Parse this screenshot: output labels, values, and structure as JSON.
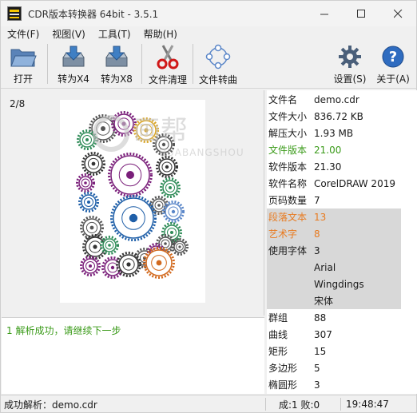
{
  "window": {
    "title": "CDR版本转换器 64bit - 3.5.1"
  },
  "menu": [
    "文件(F)",
    "视图(V)",
    "工具(T)",
    "帮助(H)"
  ],
  "toolbar": {
    "open": "打开",
    "to_x4": "转为X4",
    "to_x8": "转为X8",
    "clean": "文件清理",
    "curve": "文件转曲",
    "settings": "设置(S)",
    "about": "关于(A)"
  },
  "preview": {
    "page_indicator": "2/8"
  },
  "watermark": {
    "text": "画帮",
    "sub": "HUABANGSHOU"
  },
  "info": {
    "rows": [
      {
        "k": "文件名",
        "v": "demo.cdr"
      },
      {
        "k": "文件大小",
        "v": "836.72 KB"
      },
      {
        "k": "解压大小",
        "v": "1.93 MB"
      },
      {
        "k": "文件版本",
        "v": "21.00"
      },
      {
        "k": "软件版本",
        "v": "21.30"
      },
      {
        "k": "软件名称",
        "v": "CorelDRAW 2019"
      },
      {
        "k": "页码数量",
        "v": "7"
      },
      {
        "k": "段落文本",
        "v": "13"
      },
      {
        "k": "艺术字",
        "v": "8"
      },
      {
        "k": "使用字体",
        "v": "3"
      },
      {
        "k": "",
        "v": "Arial"
      },
      {
        "k": "",
        "v": "Wingdings"
      },
      {
        "k": "",
        "v": "宋体"
      },
      {
        "k": "群组",
        "v": "88"
      },
      {
        "k": "曲线",
        "v": "307"
      },
      {
        "k": "矩形",
        "v": "15"
      },
      {
        "k": "多边形",
        "v": "5"
      },
      {
        "k": "椭圆形",
        "v": "3"
      }
    ]
  },
  "log": {
    "line": "1  解析成功，请继续下一步"
  },
  "status": {
    "parse": "成功解析：demo.cdr",
    "counts": "成:1 败:0",
    "time": "19:48:47"
  },
  "colors": {
    "green_text": "#3b9b1a",
    "orange_text": "#e87a1f",
    "highlight_bg": "#d8d8d8"
  }
}
